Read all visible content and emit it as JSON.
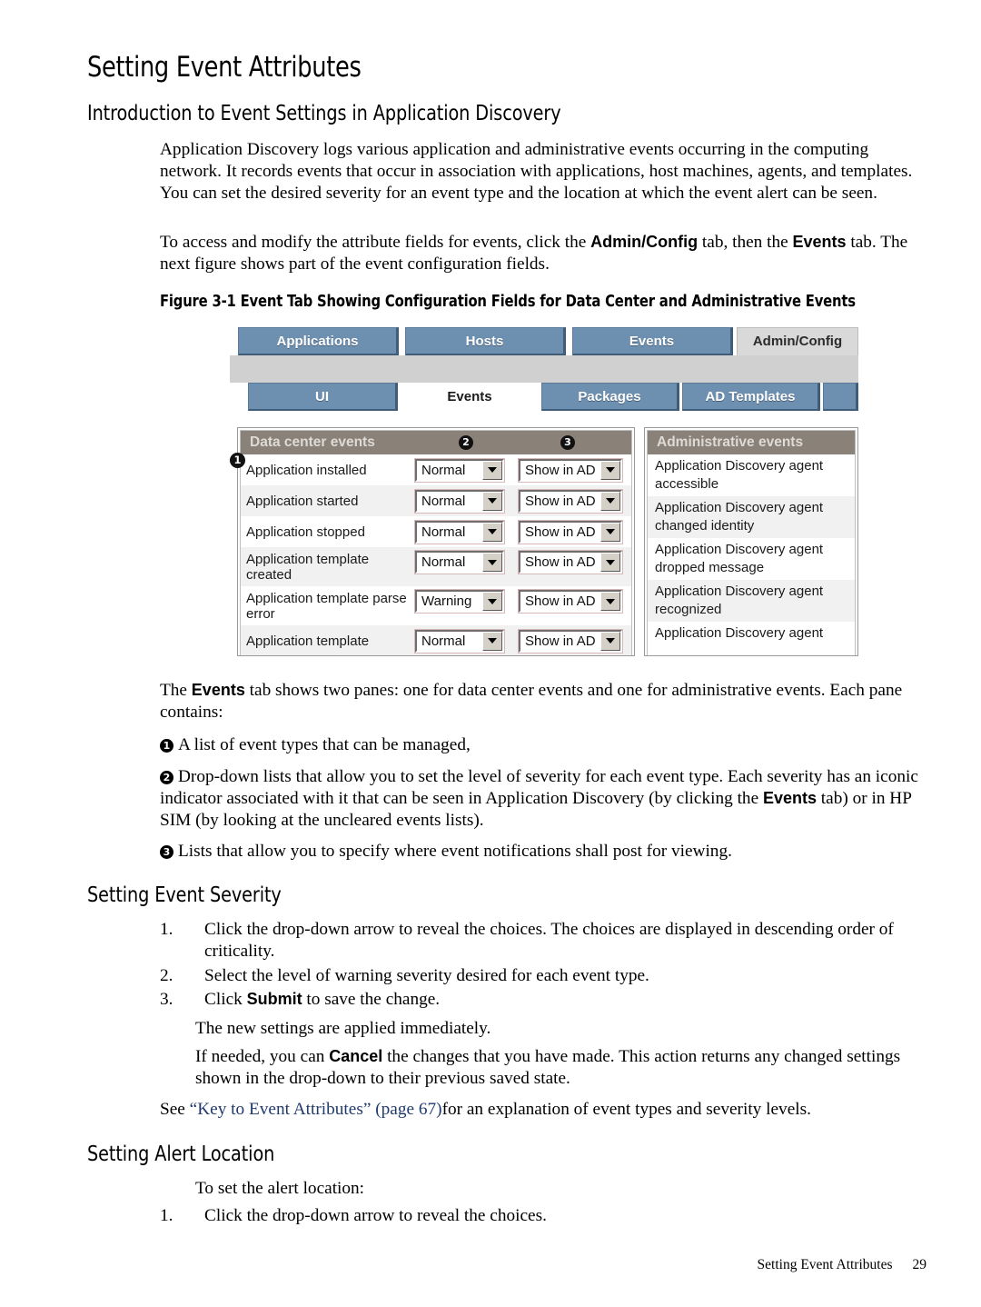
{
  "page": {
    "title": "Setting Event Attributes",
    "section_intro": "Introduction to Event Settings in Application Discovery",
    "section_severity": "Setting Event Severity",
    "section_alert": "Setting Alert Location"
  },
  "intro": {
    "p1": "Application Discovery logs various application and administrative events occurring in the computing network. It records events that occur in association with applications, host machines, agents, and templates. You can set the desired severity for an event type and the location at which the event alert can be seen.",
    "p2_a": "To access and modify the attribute fields for events, click the ",
    "p2_b1": "Admin/Config",
    "p2_c": " tab, then the ",
    "p2_b2": "Events",
    "p2_d": " tab. The next figure shows part of the event configuration fields."
  },
  "figure": {
    "caption": "Figure  3-1  Event Tab Showing Configuration Fields for Data Center and Administrative Events",
    "main_tabs": [
      {
        "label": "Applications",
        "state": "inactive"
      },
      {
        "label": "Hosts",
        "state": "inactive"
      },
      {
        "label": "Events",
        "state": "inactive"
      },
      {
        "label": "Admin/Config",
        "state": "active"
      }
    ],
    "sub_tabs": [
      {
        "label": "UI",
        "state": "inactive"
      },
      {
        "label": "Events",
        "state": "active"
      },
      {
        "label": "Packages",
        "state": "inactive"
      },
      {
        "label": "AD Templates",
        "state": "inactive"
      },
      {
        "label": "",
        "state": "stub"
      }
    ],
    "data_center": {
      "header": "Data center events",
      "badge_severity": "2",
      "badge_location": "3",
      "badge_list": "1",
      "rows": [
        {
          "name": "Application installed",
          "severity": "Normal",
          "location": "Show in AD"
        },
        {
          "name": "Application started",
          "severity": "Normal",
          "location": "Show in AD"
        },
        {
          "name": "Application stopped",
          "severity": "Normal",
          "location": "Show in AD"
        },
        {
          "name": "Application template created",
          "severity": "Normal",
          "location": "Show in AD"
        },
        {
          "name": "Application template parse error",
          "severity": "Warning",
          "location": "Show in AD"
        },
        {
          "name": "Application template",
          "severity": "Normal",
          "location": "Show in AD"
        }
      ]
    },
    "administrative": {
      "header": "Administrative events",
      "rows": [
        "Application Discovery agent accessible",
        "Application Discovery agent changed identity",
        "Application Discovery agent dropped message",
        "Application Discovery agent recognized",
        "Application Discovery agent"
      ]
    }
  },
  "panes": {
    "lead_a": "The ",
    "lead_b": "Events",
    "lead_c": " tab shows two panes: one for data center events and one for administrative events. Each pane contains:",
    "item1_badge": "1",
    "item1": "A list of event types that can be managed,",
    "item2_badge": "2",
    "item2_a": "Drop-down lists that allow you to set the level of severity for each event type. Each severity has an iconic indicator associated with it that can be seen in Application Discovery (by clicking the ",
    "item2_b": "Events",
    "item2_c": " tab) or in HP SIM (by looking at the uncleared events lists).",
    "item3_badge": "3",
    "item3": "Lists that allow you to specify where event notifications shall post for viewing."
  },
  "severity_steps": [
    {
      "num": "1.",
      "text": "Click the drop-down arrow to reveal the choices. The choices are displayed in descending order of criticality."
    },
    {
      "num": "2.",
      "text": "Select the level of warning severity desired for each event type."
    },
    {
      "num": "3.",
      "text_a": "Click ",
      "text_b": "Submit",
      "text_c": "  to save the change."
    }
  ],
  "severity_notes": {
    "applied": "The new settings are applied immediately.",
    "cancel_a": "If needed, you can ",
    "cancel_b": "Cancel",
    "cancel_c": "  the changes that you have made. This action returns any changed settings shown in the drop-down to their previous saved state."
  },
  "xref": {
    "see": "See ",
    "link": "“Key to Event Attributes” (page 67)",
    "tail": "for an explanation of event types and severity levels."
  },
  "alert": {
    "lead": "To set the alert location:",
    "step1_num": "1.",
    "step1": "Click the drop-down arrow to reveal the choices."
  },
  "footer": {
    "title": "Setting Event Attributes",
    "page_number": "29"
  }
}
